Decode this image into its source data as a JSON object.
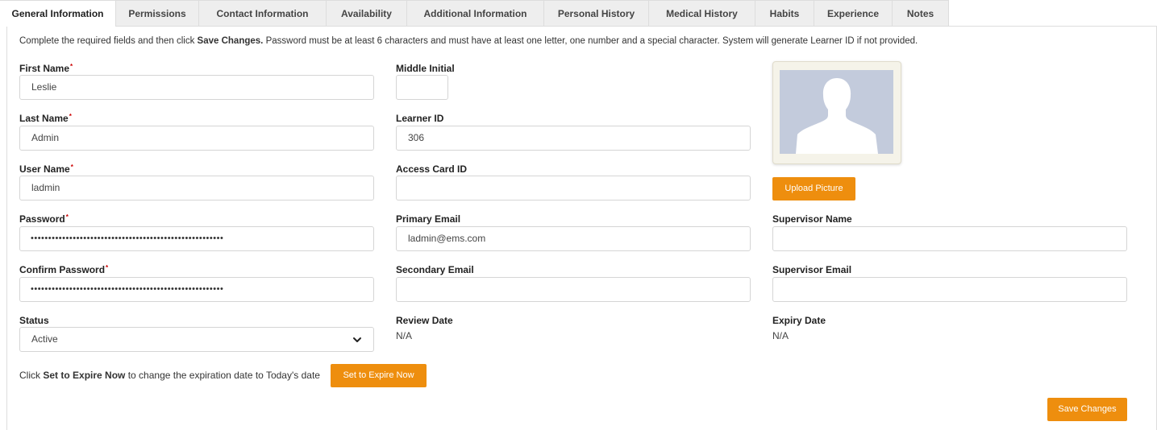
{
  "tabs": [
    {
      "label": "General Information"
    },
    {
      "label": "Permissions"
    },
    {
      "label": "Contact Information"
    },
    {
      "label": "Availability"
    },
    {
      "label": "Additional Information"
    },
    {
      "label": "Personal History"
    },
    {
      "label": "Medical History"
    },
    {
      "label": "Habits"
    },
    {
      "label": "Experience"
    },
    {
      "label": "Notes"
    }
  ],
  "instructions": {
    "part1": "Complete the required fields and then click ",
    "bold": "Save Changes.",
    "part2": " Password must be at least 6 characters and must have at least one letter, one number and a special character. System will generate Learner ID if not provided."
  },
  "required_marker": "*",
  "fields": {
    "first_name": {
      "label": "First Name",
      "value": "Leslie"
    },
    "last_name": {
      "label": "Last Name",
      "value": "Admin"
    },
    "user_name": {
      "label": "User Name",
      "value": "ladmin"
    },
    "password": {
      "label": "Password",
      "value": "•••••••••••••••••••••••••••••••••••••••••••••••••••••••"
    },
    "confirm_password": {
      "label": "Confirm Password",
      "value": "•••••••••••••••••••••••••••••••••••••••••••••••••••••••"
    },
    "status": {
      "label": "Status",
      "value": "Active"
    },
    "middle_initial": {
      "label": "Middle Initial",
      "value": ""
    },
    "learner_id": {
      "label": "Learner ID",
      "value": "306"
    },
    "access_card_id": {
      "label": "Access Card ID",
      "value": ""
    },
    "primary_email": {
      "label": "Primary Email",
      "value": "ladmin@ems.com"
    },
    "secondary_email": {
      "label": "Secondary Email",
      "value": ""
    },
    "review_date": {
      "label": "Review Date",
      "value": "N/A"
    },
    "supervisor_name": {
      "label": "Supervisor Name",
      "value": ""
    },
    "supervisor_email": {
      "label": "Supervisor Email",
      "value": ""
    },
    "expiry_date": {
      "label": "Expiry Date",
      "value": "N/A"
    }
  },
  "buttons": {
    "upload_picture": "Upload Picture",
    "set_to_expire": "Set to Expire Now",
    "save_changes": "Save Changes"
  },
  "expire_text": {
    "part1": "Click ",
    "bold": "Set to Expire Now",
    "part2": " to change the expiration date to Today's date"
  },
  "icons": {
    "avatar_placeholder": "person-silhouette-icon",
    "status_dropdown": "chevron-down-icon"
  },
  "colors": {
    "accent": "#ee8e0e",
    "photo_background": "#c3cbdc"
  }
}
